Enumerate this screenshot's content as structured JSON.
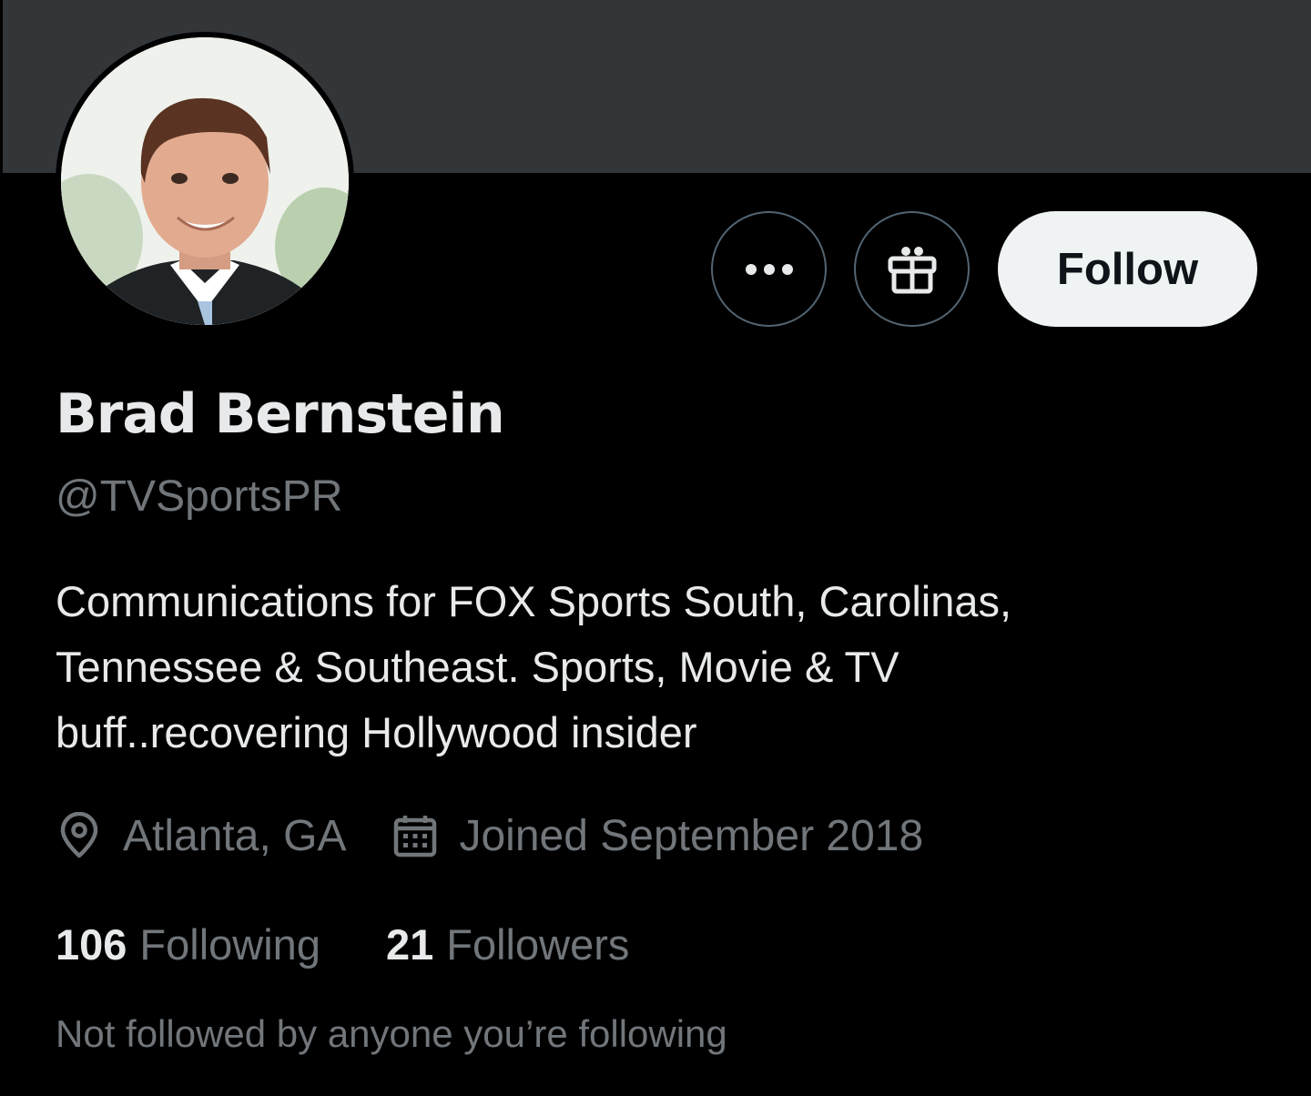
{
  "profile": {
    "display_name": "Brad Bernstein",
    "handle": "@TVSportsPR",
    "bio_lines": [
      "Communications for FOX Sports South, Carolinas,",
      "Tennessee & Southeast. Sports, Movie & TV",
      "buff..recovering Hollywood insider"
    ],
    "location": "Atlanta, GA",
    "joined": "Joined September 2018",
    "following_count": "106",
    "following_label": "Following",
    "followers_count": "21",
    "followers_label": "Followers",
    "social_context": "Not followed by anyone you’re following"
  },
  "actions": {
    "follow_label": "Follow",
    "more_icon": "more-options-icon",
    "gift_icon": "gift-icon"
  },
  "colors": {
    "background": "#000000",
    "banner": "#333639",
    "primary_text": "#e7e9ea",
    "secondary_text": "#71767b",
    "button_border": "#536471",
    "follow_bg": "#eff3f4",
    "follow_text": "#0f1419"
  }
}
